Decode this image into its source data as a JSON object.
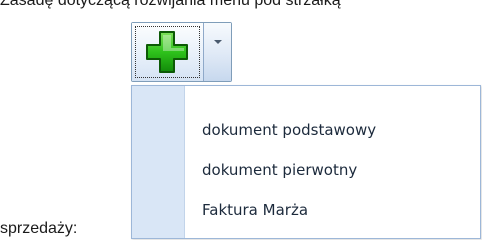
{
  "text": {
    "intro": "Zasadę dotyczącą rozwijania menu pod strzałką",
    "trailing": "sprzedaży:"
  },
  "button": {
    "main_icon": "plus-icon",
    "arrow_icon": "chevron-down-icon"
  },
  "menu": {
    "items": [
      {
        "label": "dokument podstawowy"
      },
      {
        "label": "dokument pierwotny"
      },
      {
        "label": "Faktura Marża"
      }
    ]
  },
  "colors": {
    "plus_green": "#22b014",
    "plus_outline": "#0d5a06",
    "menu_gutter": "#d9e6f6",
    "menu_border": "#9db7d8",
    "button_border": "#7f9db9"
  }
}
